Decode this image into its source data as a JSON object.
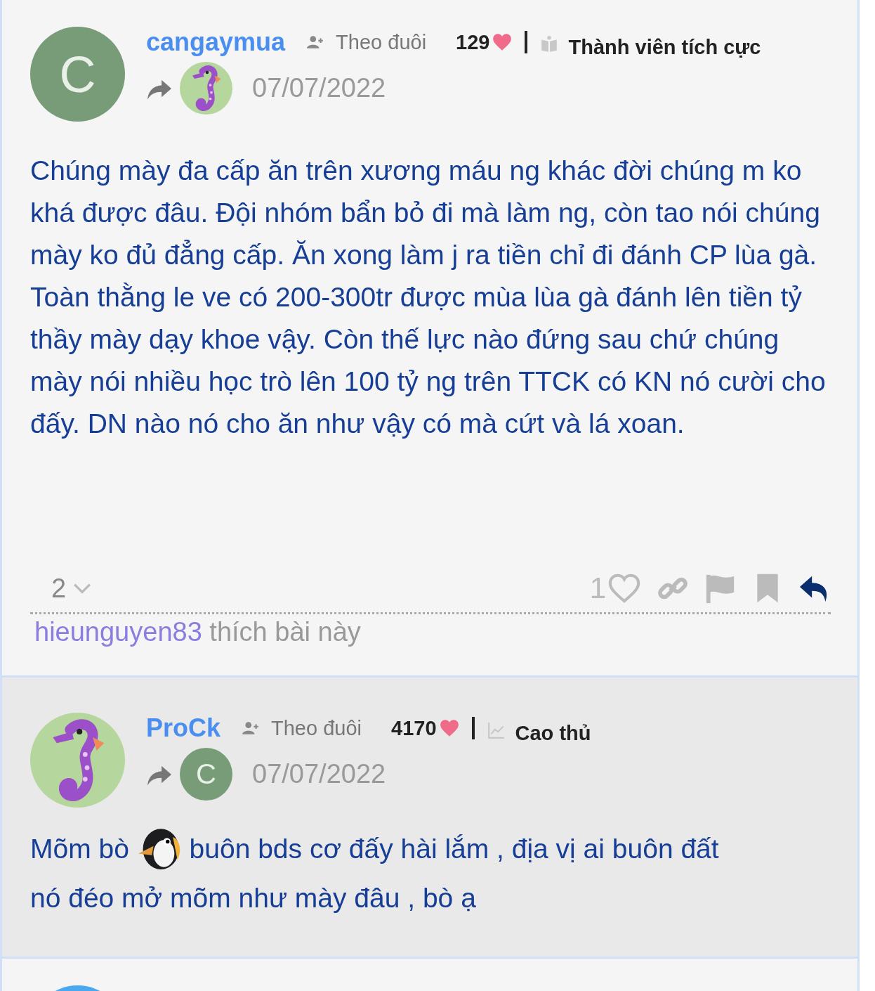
{
  "posts": [
    {
      "highlighted": false,
      "author": {
        "name": "cangaymua",
        "avatar": {
          "kind": "letter",
          "letter": "C",
          "color": "#789c78"
        }
      },
      "follow_label": "Theo đuôi",
      "points": "129",
      "rank": {
        "kind": "book",
        "label": "Thành viên tích cực"
      },
      "reply_to": {
        "kind": "seahorse"
      },
      "date": "07/07/2022",
      "body": [
        {
          "kind": "text",
          "text": "Chúng mày đa cấp ăn trên xương máu ng khác đời chúng m ko khá được đâu. Đội nhóm bẩn bỏ đi mà làm ng, còn tao nói chúng mày ko đủ đẳng cấp. Ăn xong làm j ra tiền chỉ đi đánh CP lùa gà. Toàn thằng le ve có 200-300tr được mùa lùa gà đánh lên tiền tỷ thầy mày dạy khoe vậy. Còn thế lực nào đứng sau chứ chúng mày nói nhiều học trò lên 100 tỷ ng trên TTCK có KN nó cười cho đấy. DN nào nó cho ăn như vậy có mà cứt và lá xoan."
        }
      ],
      "footer": {
        "replies": "2",
        "likes": "1",
        "liked": false
      },
      "liked_by": {
        "user": "hieunguyen83",
        "text": "thích bài này"
      }
    },
    {
      "highlighted": true,
      "author": {
        "name": "ProCk",
        "avatar": {
          "kind": "seahorse"
        }
      },
      "follow_label": "Theo đuôi",
      "points": "4170",
      "rank": {
        "kind": "chart",
        "label": "Cao thủ"
      },
      "reply_to": {
        "kind": "letter",
        "letter": "C",
        "color": "#789c78"
      },
      "date": "07/07/2022",
      "body": [
        {
          "kind": "text",
          "text": "Mõm bò"
        },
        {
          "kind": "emoji"
        },
        {
          "kind": "text",
          "text": "buôn bds cơ đấy hài lắm , địa vị ai buôn đất"
        },
        {
          "kind": "break"
        },
        {
          "kind": "text",
          "text": "nó đéo mở mõm như mày đâu , bò ạ"
        }
      ]
    },
    {
      "highlighted": false,
      "author": {
        "avatar": {
          "kind": "blank",
          "color": "#4aa8f0"
        }
      }
    }
  ]
}
